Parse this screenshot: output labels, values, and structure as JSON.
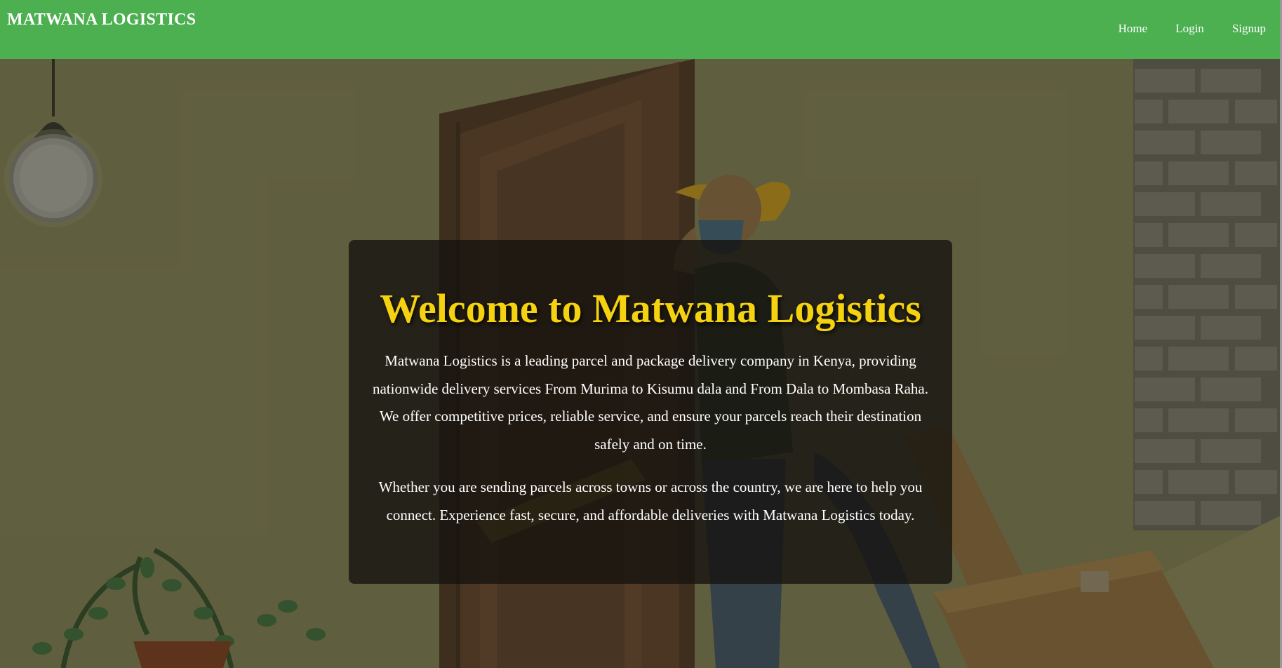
{
  "header": {
    "brand": "MATWANA LOGISTICS",
    "nav": [
      {
        "label": "Home"
      },
      {
        "label": "Login"
      },
      {
        "label": "Signup"
      }
    ]
  },
  "hero": {
    "title": "Welcome to Matwana Logistics",
    "paragraphs": [
      "Matwana Logistics is a leading parcel and package delivery company in Kenya, providing nationwide delivery services From Murima to Kisumu dala and From Dala to Mombasa Raha. We offer competitive prices, reliable service, and ensure your parcels reach their destination safely and on time.",
      "Whether you are sending parcels across towns or across the country, we are here to help you connect. Experience fast, secure, and affordable deliveries with Matwana Logistics today."
    ]
  },
  "colors": {
    "navbar": "#4caf50",
    "title": "#f5d20f",
    "text": "#ffffff",
    "card": "#14120e"
  },
  "icons": {
    "lamp": "pendant-lamp-illustration",
    "plant": "potted-plant-illustration",
    "door": "door-illustration",
    "courier": "delivery-man-illustration"
  }
}
